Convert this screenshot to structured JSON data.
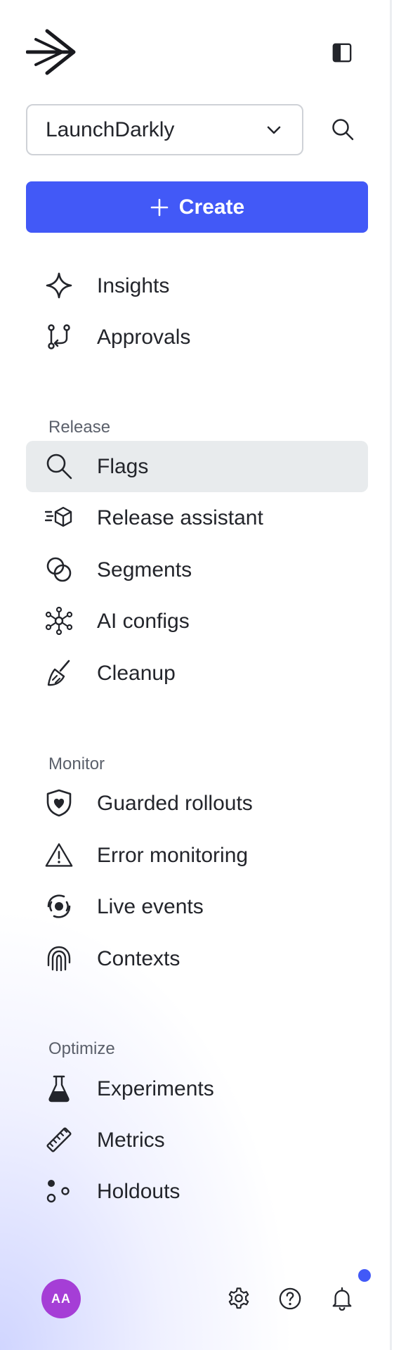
{
  "project": {
    "name": "LaunchDarkly"
  },
  "create": {
    "label": "Create"
  },
  "top_nav": [
    {
      "label": "Insights",
      "icon": "sparkle-icon"
    },
    {
      "label": "Approvals",
      "icon": "approvals-icon"
    }
  ],
  "sections": {
    "release": {
      "label": "Release",
      "items": [
        {
          "label": "Flags",
          "icon": "search-icon",
          "active": true
        },
        {
          "label": "Release assistant",
          "icon": "release-assistant-icon"
        },
        {
          "label": "Segments",
          "icon": "segments-icon"
        },
        {
          "label": "AI configs",
          "icon": "ai-configs-icon"
        },
        {
          "label": "Cleanup",
          "icon": "broom-icon"
        }
      ]
    },
    "monitor": {
      "label": "Monitor",
      "items": [
        {
          "label": "Guarded rollouts",
          "icon": "shield-heart-icon"
        },
        {
          "label": "Error monitoring",
          "icon": "warning-triangle-icon"
        },
        {
          "label": "Live events",
          "icon": "live-events-icon"
        },
        {
          "label": "Contexts",
          "icon": "fingerprint-icon"
        }
      ]
    },
    "optimize": {
      "label": "Optimize",
      "items": [
        {
          "label": "Experiments",
          "icon": "flask-icon"
        },
        {
          "label": "Metrics",
          "icon": "ruler-icon"
        },
        {
          "label": "Holdouts",
          "icon": "holdouts-icon"
        }
      ]
    }
  },
  "user": {
    "initials": "AA"
  },
  "colors": {
    "accent": "#4259f7",
    "avatar": "#a53ed6",
    "active_bg": "#e8ebed"
  }
}
